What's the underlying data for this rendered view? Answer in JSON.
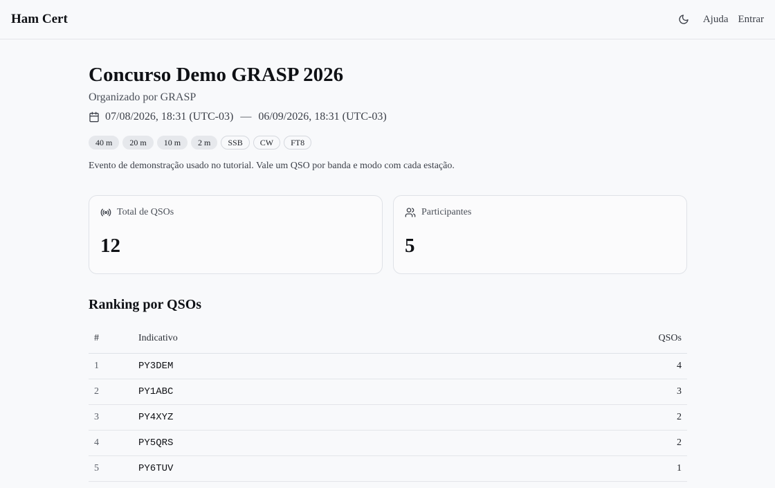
{
  "header": {
    "brand": "Ham Cert",
    "nav": {
      "theme_icon": "moon-icon",
      "help": "Ajuda",
      "login": "Entrar"
    }
  },
  "event": {
    "title": "Concurso Demo GRASP 2026",
    "organizer": "Organizado por GRASP",
    "start": "07/08/2026, 18:31 (UTC-03)",
    "separator": "—",
    "end": "06/09/2026, 18:31 (UTC-03)",
    "bands": [
      "40 m",
      "20 m",
      "10 m",
      "2 m"
    ],
    "modes": [
      "SSB",
      "CW",
      "FT8"
    ],
    "description": "Evento de demonstração usado no tutorial. Vale um QSO por banda e modo com cada estação."
  },
  "stats": {
    "total_label": "Total de QSOs",
    "total_value": "12",
    "participants_label": "Participantes",
    "participants_value": "5"
  },
  "ranking": {
    "title": "Ranking por QSOs",
    "columns": {
      "rank": "#",
      "callsign": "Indicativo",
      "qsos": "QSOs"
    },
    "rows": [
      {
        "rank": "1",
        "callsign": "PY3DEM",
        "qsos": "4"
      },
      {
        "rank": "2",
        "callsign": "PY1ABC",
        "qsos": "3"
      },
      {
        "rank": "3",
        "callsign": "PY4XYZ",
        "qsos": "2"
      },
      {
        "rank": "4",
        "callsign": "PY5QRS",
        "qsos": "2"
      },
      {
        "rank": "5",
        "callsign": "PY6TUV",
        "qsos": "1"
      }
    ]
  }
}
